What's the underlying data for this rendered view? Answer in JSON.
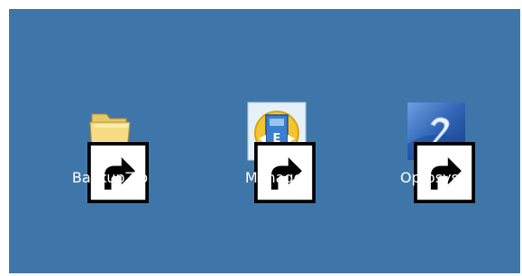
{
  "desktop": {
    "background_color": "#3f76a9",
    "icons": [
      {
        "label": "BackupZip",
        "icon": "folder-shortcut-icon"
      },
      {
        "label": "Manager",
        "icon": "manager-app-shortcut-icon"
      },
      {
        "label": "Optosys 2",
        "icon": "optosys-2-shortcut-icon"
      }
    ]
  }
}
